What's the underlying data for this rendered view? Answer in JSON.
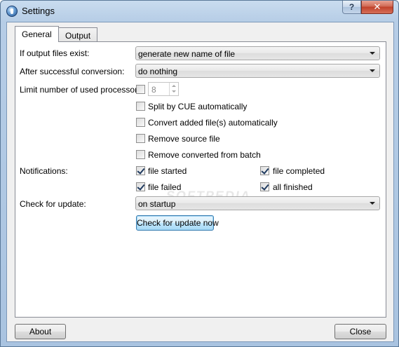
{
  "window": {
    "title": "Settings",
    "help_label": "?",
    "close_label": "✕"
  },
  "tabs": {
    "general": "General",
    "output": "Output"
  },
  "general": {
    "output_exists_label": "If output files exist:",
    "output_exists_value": "generate new name of file",
    "after_conversion_label": "After successful conversion:",
    "after_conversion_value": "do nothing",
    "limit_processors_label": "Limit number of used processors:",
    "limit_processors_checked": false,
    "processors_count": "8",
    "split_cue_label": "Split by CUE automatically",
    "split_cue_checked": false,
    "convert_added_label": "Convert added file(s) automatically",
    "convert_added_checked": false,
    "remove_source_label": "Remove source file",
    "remove_source_checked": false,
    "remove_converted_label": "Remove converted from batch",
    "remove_converted_checked": false,
    "notifications_label": "Notifications:",
    "notif_file_started": "file started",
    "notif_file_completed": "file completed",
    "notif_file_failed": "file failed",
    "notif_all_finished": "all finished",
    "check_update_label": "Check for update:",
    "check_update_value": "on startup",
    "check_update_now_label": "Check for update now"
  },
  "watermark": "SOFTPEDIA",
  "footer": {
    "about_label": "About",
    "close_label": "Close"
  }
}
